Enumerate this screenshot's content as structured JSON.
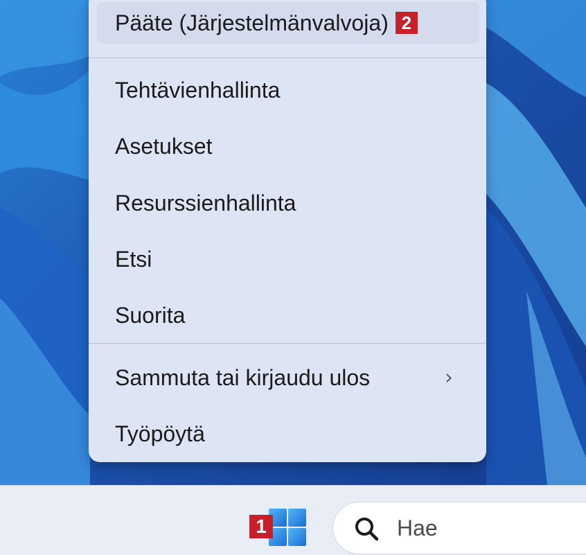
{
  "menu": {
    "items": [
      {
        "label": "Pääte (Järjestelmänvalvoja)",
        "badge": "2"
      },
      {
        "label": "Tehtävienhallinta"
      },
      {
        "label": "Asetukset"
      },
      {
        "label": "Resurssienhallinta"
      },
      {
        "label": "Etsi"
      },
      {
        "label": "Suorita"
      },
      {
        "label": "Sammuta tai kirjaudu ulos",
        "chevron": "›"
      },
      {
        "label": "Työpöytä"
      }
    ]
  },
  "taskbar": {
    "start_badge": "1",
    "search_placeholder": "Hae"
  },
  "colors": {
    "badge": "#c8202b",
    "wallpaper": "#1d4fa8",
    "menu_background": "#dde4f3"
  }
}
